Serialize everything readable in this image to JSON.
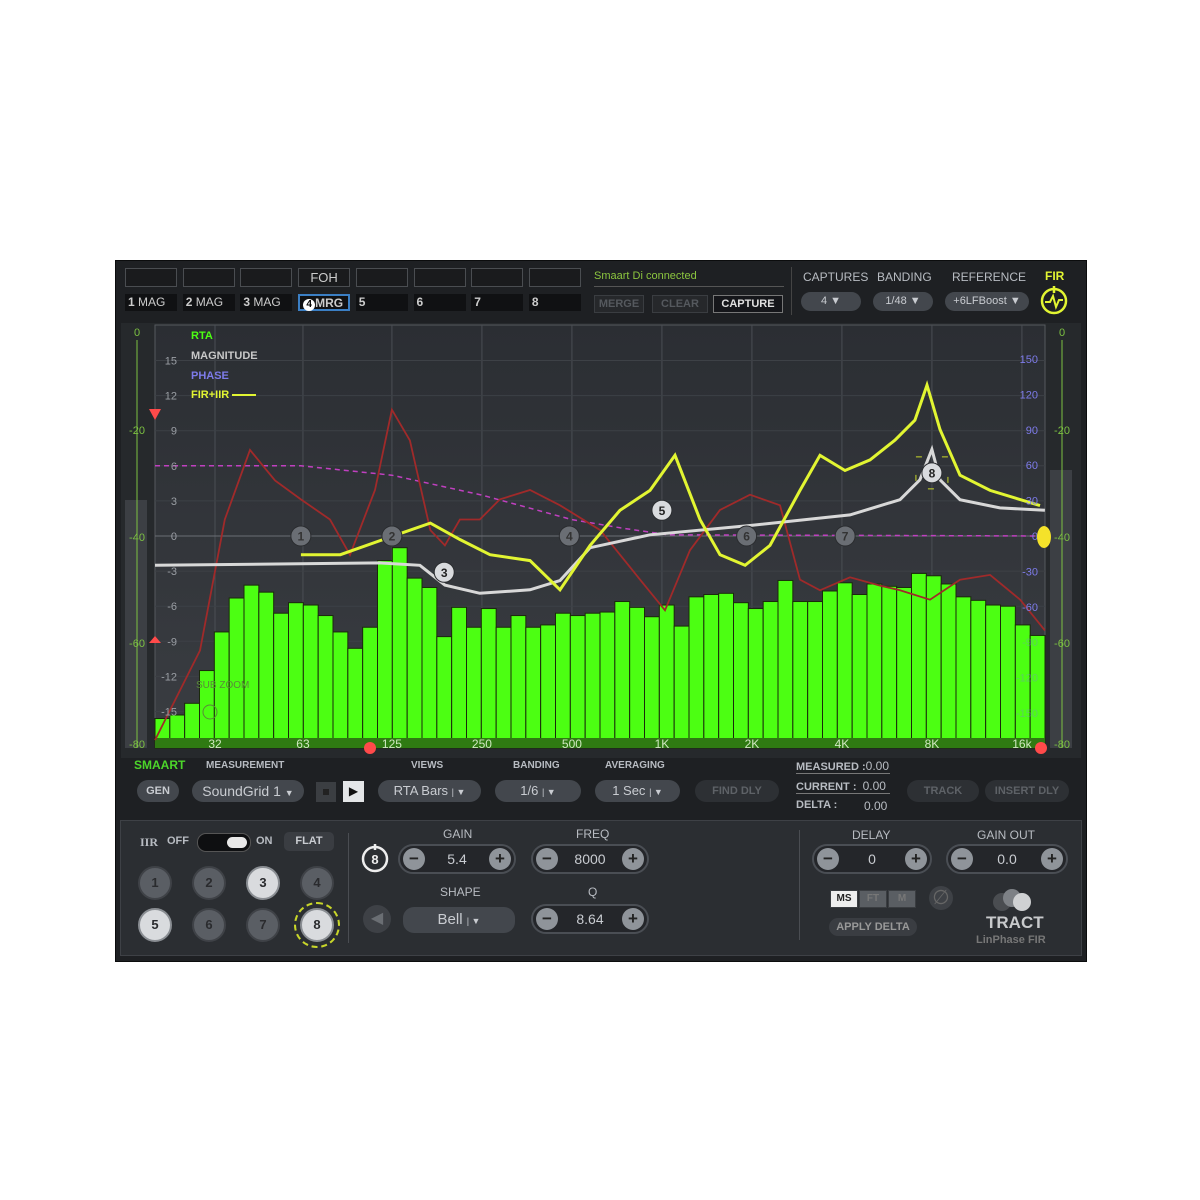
{
  "top": {
    "names": [
      "",
      "",
      "",
      "FOH",
      "",
      "",
      "",
      ""
    ],
    "slots": [
      "1 MAG",
      "2 MAG",
      "3 MAG",
      "MRG",
      "5",
      "6",
      "7",
      "8"
    ],
    "active_slot_badge": "4",
    "status": "Smaart Di connected",
    "merge": "MERGE",
    "clear": "CLEAR",
    "capture": "CAPTURE",
    "captures_label": "CAPTURES",
    "captures_value": "4",
    "banding_label": "BANDING",
    "banding_value": "1/48",
    "reference_label": "REFERENCE",
    "reference_value": "+6LFBoost",
    "fir_label": "FIR"
  },
  "legend": {
    "rta": "RTA",
    "magnitude": "MAGNITUDE",
    "phase": "PHASE",
    "firiir": "FIR+IIR"
  },
  "colors": {
    "rta": "#4cff12",
    "magnitude": "#d8d8d8",
    "phase": "#a02a2a",
    "firiir": "#e2f532",
    "target": "#c040c0",
    "phase_axis": "#7d7bea",
    "meter": "#7cc142"
  },
  "meter_labels": [
    "0",
    "-20",
    "-40",
    "-60",
    "-80"
  ],
  "sub_zoom": "SUB ZOOM",
  "chart_data": {
    "type": "line",
    "x_scale": "log",
    "x_ticks": [
      32,
      63,
      125,
      250,
      500,
      1000,
      2000,
      4000,
      8000,
      16000
    ],
    "x_tick_labels": [
      "32",
      "63",
      "125",
      "250",
      "500",
      "1K",
      "2K",
      "4K",
      "8K",
      "16k"
    ],
    "y_ticks": [
      15,
      12,
      9,
      6,
      3,
      0,
      -3,
      -6,
      -9,
      -12,
      -15
    ],
    "y2_ticks": [
      150,
      120,
      90,
      60,
      30,
      0,
      -30,
      -60,
      -90,
      -120,
      -150
    ],
    "ylim": [
      -18,
      18
    ],
    "grid": true,
    "legend_placement": "top-left",
    "rta_bars_db": [
      -15.6,
      -15.3,
      -14.3,
      -11.5,
      -8.2,
      -5.3,
      -4.2,
      -4.8,
      -6.6,
      -5.7,
      -5.9,
      -6.8,
      -8.2,
      -9.6,
      -7.8,
      -2.1,
      -1.0,
      -3.6,
      -4.4,
      -8.6,
      -6.1,
      -7.8,
      -6.2,
      -7.8,
      -6.8,
      -7.8,
      -7.6,
      -6.6,
      -6.8,
      -6.6,
      -6.5,
      -5.6,
      -6.1,
      -6.9,
      -5.9,
      -7.7,
      -5.2,
      -5.0,
      -4.9,
      -5.7,
      -6.2,
      -5.6,
      -3.8,
      -5.6,
      -5.6,
      -4.7,
      -4.0,
      -5.0,
      -4.1,
      -4.3,
      -4.4,
      -3.2,
      -3.4,
      -4.1,
      -5.2,
      -5.5,
      -5.9,
      -6.0,
      -7.6,
      -8.5
    ],
    "series": [
      {
        "name": "FIR+IIR",
        "points": [
          [
            62,
            -1.6
          ],
          [
            84,
            -1.6
          ],
          [
            123,
            -0.1
          ],
          [
            168,
            1.1
          ],
          [
            211,
            -0.3
          ],
          [
            266,
            -1.6
          ],
          [
            362,
            -2.1
          ],
          [
            456,
            -4.6
          ],
          [
            575,
            -0.8
          ],
          [
            724,
            2.2
          ],
          [
            912,
            3.9
          ],
          [
            1106,
            6.9
          ],
          [
            1341,
            1.4
          ],
          [
            1564,
            -1.6
          ],
          [
            1897,
            -2.5
          ],
          [
            2299,
            -0.8
          ],
          [
            2896,
            3.9
          ],
          [
            3379,
            6.9
          ],
          [
            4096,
            5.6
          ],
          [
            4967,
            6.5
          ],
          [
            6020,
            8.2
          ],
          [
            7017,
            9.9
          ],
          [
            7703,
            12.9
          ],
          [
            8515,
            9.1
          ],
          [
            9930,
            5.2
          ],
          [
            12520,
            3.9
          ],
          [
            18390,
            2.6
          ]
        ]
      },
      {
        "name": "MAGNITUDE",
        "points": [
          [
            20,
            -2.5
          ],
          [
            114,
            -2.3
          ],
          [
            155,
            -2.5
          ],
          [
            188,
            -4.2
          ],
          [
            246,
            -4.9
          ],
          [
            362,
            -4.6
          ],
          [
            456,
            -3.8
          ],
          [
            575,
            -1.0
          ],
          [
            912,
            0.1
          ],
          [
            1971,
            0.9
          ],
          [
            4256,
            1.8
          ],
          [
            6257,
            3.1
          ],
          [
            7295,
            4.8
          ],
          [
            8000,
            7.4
          ],
          [
            8515,
            4.8
          ],
          [
            9930,
            3.1
          ],
          [
            13500,
            2.4
          ],
          [
            19100,
            2.2
          ]
        ]
      },
      {
        "name": "PHASE",
        "unit": "deg",
        "points": [
          [
            20,
            -173
          ],
          [
            28.5,
            -97
          ],
          [
            34.5,
            14
          ],
          [
            41.9,
            73
          ],
          [
            50.8,
            47
          ],
          [
            62,
            31
          ],
          [
            77.6,
            14
          ],
          [
            90.5,
            -16
          ],
          [
            109.7,
            39
          ],
          [
            125,
            107
          ],
          [
            143.6,
            81
          ],
          [
            168,
            5
          ],
          [
            188,
            -8
          ],
          [
            211,
            14
          ],
          [
            246,
            14
          ],
          [
            287,
            31
          ],
          [
            362,
            39
          ],
          [
            456,
            26
          ],
          [
            621,
            5
          ],
          [
            845,
            -37
          ],
          [
            1024,
            -63
          ],
          [
            1241,
            -12
          ],
          [
            1564,
            22
          ],
          [
            1971,
            35
          ],
          [
            2483,
            26
          ],
          [
            2896,
            -37
          ],
          [
            3379,
            -46
          ],
          [
            4256,
            -35
          ],
          [
            5365,
            -42
          ],
          [
            6257,
            -46
          ],
          [
            7884,
            -54
          ],
          [
            9930,
            -37
          ],
          [
            12520,
            -33
          ],
          [
            15790,
            -54
          ],
          [
            19100,
            -80
          ]
        ]
      },
      {
        "name": "target",
        "points": [
          [
            20,
            6.0
          ],
          [
            62,
            6.0
          ],
          [
            125,
            5.2
          ],
          [
            250,
            3.5
          ],
          [
            500,
            1.4
          ],
          [
            724,
            0.7
          ],
          [
            1050,
            0.1
          ],
          [
            20000,
            0
          ]
        ]
      }
    ],
    "eq_bands": [
      {
        "label": "1",
        "freq": 62,
        "gain": 0
      },
      {
        "label": "2",
        "freq": 125,
        "gain": 0
      },
      {
        "label": "3",
        "freq": 187,
        "gain": -3.1
      },
      {
        "label": "4",
        "freq": 490,
        "gain": 0
      },
      {
        "label": "5",
        "freq": 1000,
        "gain": 2.2
      },
      {
        "label": "6",
        "freq": 1920,
        "gain": 0
      },
      {
        "label": "7",
        "freq": 4100,
        "gain": 0
      },
      {
        "label": "8",
        "freq": 8000,
        "gain": 5.4
      }
    ]
  },
  "smaart": {
    "title": "SMAART",
    "gen": "GEN",
    "measurement_label": "MEASUREMENT",
    "measurement_value": "SoundGrid 1",
    "views_label": "VIEWS",
    "views_value": "RTA Bars",
    "banding_label": "BANDING",
    "banding_value": "1/6",
    "averaging_label": "AVERAGING",
    "averaging_value": "1 Sec",
    "find_dly": "FIND DLY",
    "measured_label": "MEASURED :",
    "measured_value": "0.00",
    "current_label": "CURRENT :",
    "current_value": "0.00",
    "delta_label": "DELTA :",
    "delta_value": "0.00",
    "track": "TRACK",
    "insert_dly": "INSERT DLY"
  },
  "eq": {
    "iir": "IIR",
    "off": "OFF",
    "on": "ON",
    "flat": "FLAT",
    "iir_on": true,
    "bands": [
      "1",
      "2",
      "3",
      "4",
      "5",
      "6",
      "7",
      "8"
    ],
    "selected_band": "8",
    "gain_label": "GAIN",
    "gain": "5.4",
    "freq_label": "FREQ",
    "freq": "8000",
    "shape_label": "SHAPE",
    "shape": "Bell",
    "q_label": "Q",
    "q": "8.64"
  },
  "output": {
    "delay_label": "DELAY",
    "delay": "0",
    "gain_out_label": "GAIN OUT",
    "gain_out": "0.0",
    "units": [
      "MS",
      "FT",
      "M"
    ],
    "unit_selected": "MS",
    "apply_delta": "APPLY DELTA",
    "brand": "TRACT",
    "brand_sub": "LinPhase FIR"
  }
}
